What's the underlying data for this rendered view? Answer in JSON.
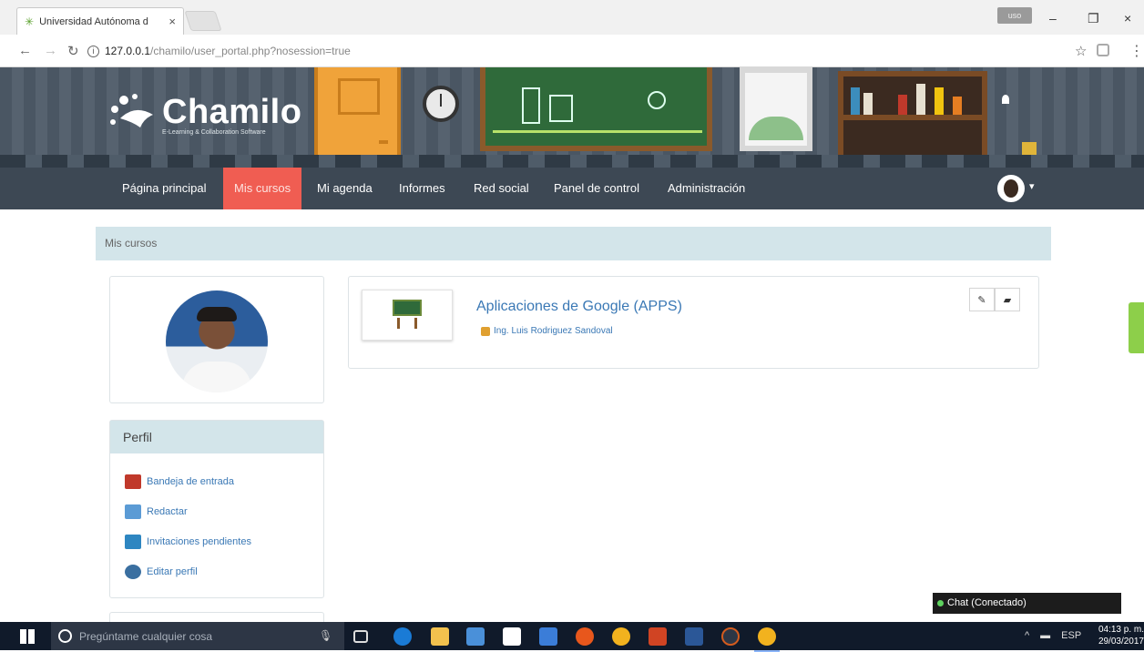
{
  "browser": {
    "tab_title": "Universidad Autónoma d",
    "tab_close": "×",
    "user_chip": "uso",
    "window_controls": {
      "minimize": "–",
      "maximize": "❐",
      "close": "×"
    },
    "url_host": "127.0.0.1",
    "url_path": "/chamilo/user_portal.php?nosession=true"
  },
  "header": {
    "logo_text": "Chamilo",
    "logo_subtitle": "E-Learning & Collaboration Software"
  },
  "nav": {
    "items": [
      {
        "label": "Página principal",
        "active": false
      },
      {
        "label": "Mis cursos",
        "active": true
      },
      {
        "label": "Mi agenda",
        "active": false
      },
      {
        "label": "Informes",
        "active": false
      },
      {
        "label": "Red social",
        "active": false
      },
      {
        "label": "Panel de control",
        "active": false
      },
      {
        "label": "Administración",
        "active": false
      }
    ],
    "caret": "▾"
  },
  "breadcrumb": {
    "label": "Mis cursos"
  },
  "perfil": {
    "title": "Perfil",
    "items": [
      {
        "label": "Bandeja de entrada",
        "icon": "inbox-icon",
        "color": "#c0392b"
      },
      {
        "label": "Redactar",
        "icon": "compose-icon",
        "color": "#5b9bd5"
      },
      {
        "label": "Invitaciones pendientes",
        "icon": "invitations-icon",
        "color": "#2e86c1"
      },
      {
        "label": "Editar perfil",
        "icon": "edit-profile-icon",
        "color": "#3a6fa0"
      }
    ]
  },
  "course": {
    "title": "Aplicaciones de Google (APPS)",
    "teacher": "Ing. Luis Rodriguez Sandoval",
    "actions": {
      "edit": "✎",
      "folder": "▰"
    }
  },
  "chat": {
    "label": "Chat (Conectado)"
  },
  "taskbar": {
    "search_placeholder": "Pregúntame cualquier cosa",
    "language": "ESP",
    "time": "04:13 p. m.",
    "date": "29/03/2017"
  },
  "colors": {
    "nav_bg": "#3d4854",
    "nav_active": "#f05d52",
    "panel_head": "#d3e5ea",
    "link": "#3a78b5"
  }
}
